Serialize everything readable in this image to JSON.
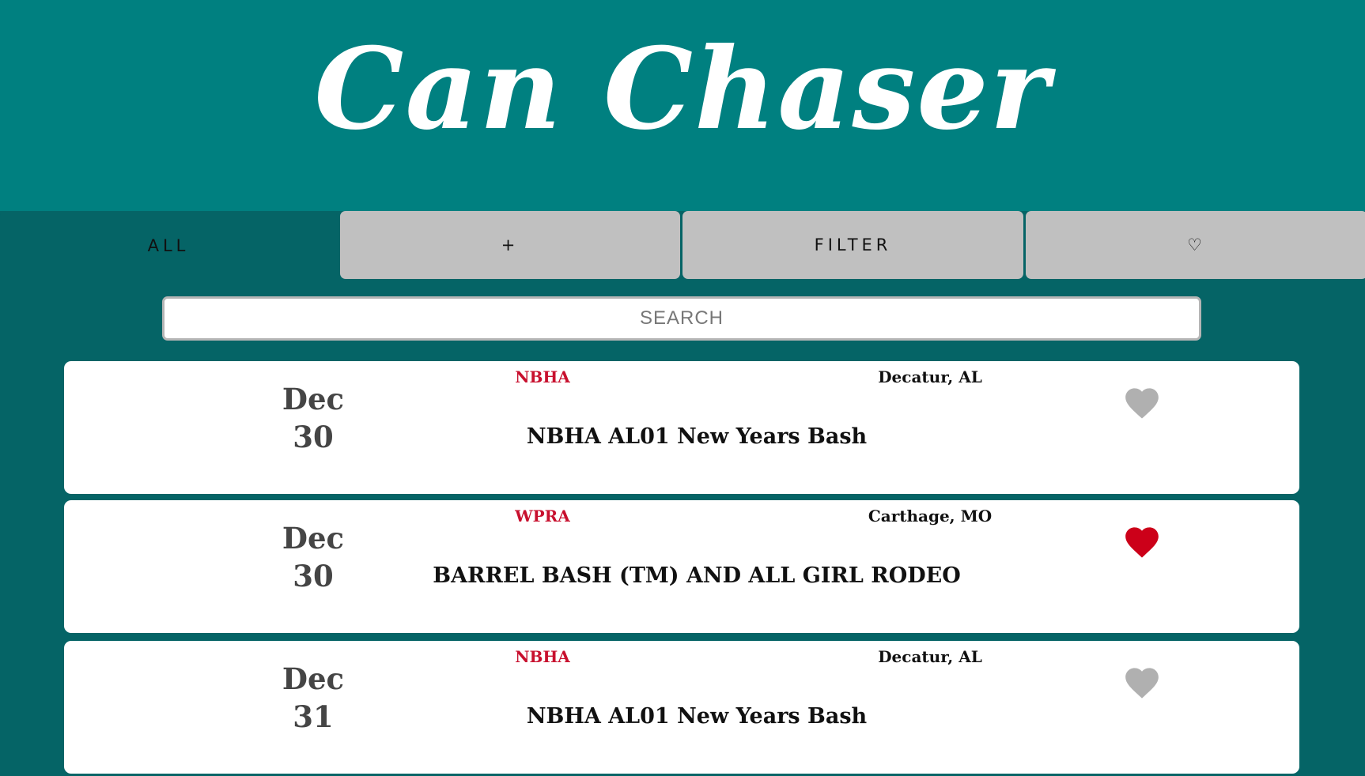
{
  "app": {
    "title": "Can Chaser"
  },
  "tabs": [
    {
      "label": "ALL",
      "active": true
    },
    {
      "label": "+",
      "active": false
    },
    {
      "label": "FILTER",
      "active": false
    },
    {
      "label": "♡",
      "active": false
    }
  ],
  "search": {
    "placeholder": "SEARCH",
    "value": ""
  },
  "colors": {
    "header_bg": "#008080",
    "body_bg": "#056466",
    "tab_bg": "#c0c0c0",
    "org_red": "#c8102e",
    "heart_gray": "#b0b0b0",
    "heart_red": "#cc0019"
  },
  "events": [
    {
      "month": "Dec",
      "day": "30",
      "org": "NBHA",
      "location": "Decatur, AL",
      "name": "NBHA AL01 New Years Bash",
      "favorited": false,
      "icon": "heart-icon"
    },
    {
      "month": "Dec",
      "day": "30",
      "org": "WPRA",
      "location": "Carthage, MO",
      "name": "BARREL BASH (TM) AND ALL GIRL RODEO",
      "favorited": true,
      "icon": "heart-icon"
    },
    {
      "month": "Dec",
      "day": "31",
      "org": "NBHA",
      "location": "Decatur, AL",
      "name": "NBHA AL01 New Years Bash",
      "favorited": false,
      "icon": "heart-icon"
    }
  ]
}
